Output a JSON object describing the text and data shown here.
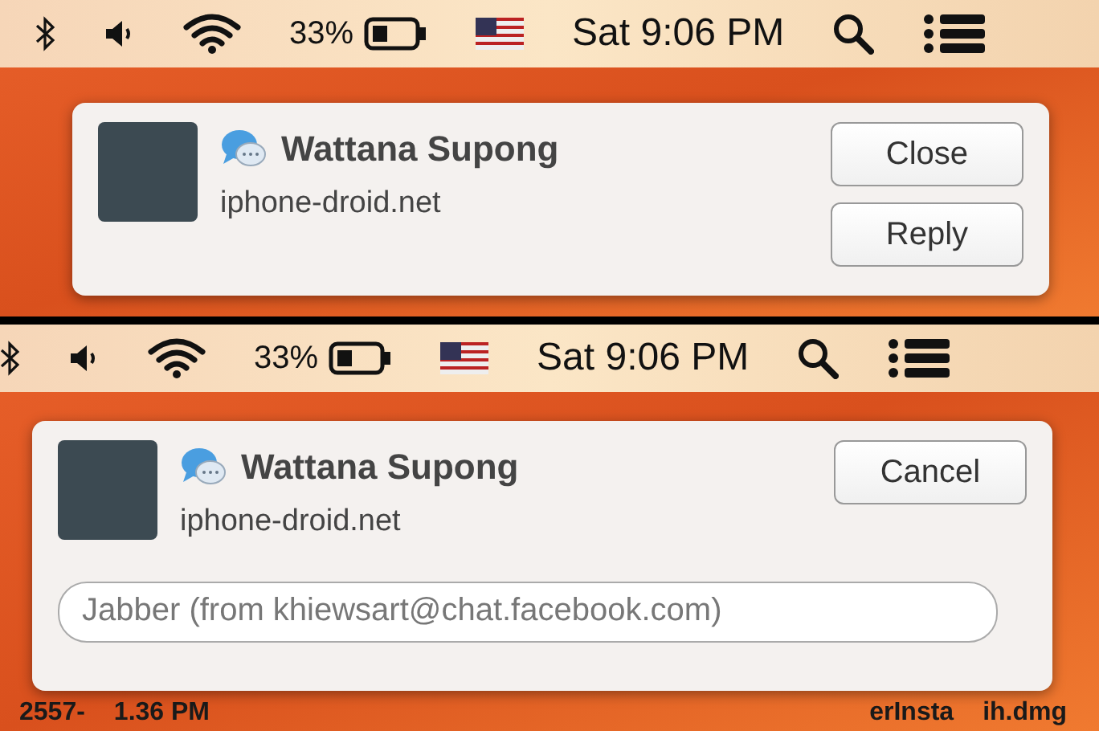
{
  "panels": [
    {
      "menu_bar": {
        "battery_percent": "33%",
        "clock": "Sat 9:06 PM"
      },
      "notification": {
        "sender": "Wattana Supong",
        "subtitle": "iphone-droid.net",
        "buttons": [
          "Close",
          "Reply"
        ]
      }
    },
    {
      "menu_bar": {
        "battery_percent": "33%",
        "clock": "Sat 9:06 PM"
      },
      "notification": {
        "sender": "Wattana Supong",
        "subtitle": "iphone-droid.net",
        "buttons": [
          "Cancel"
        ],
        "reply_field": {
          "placeholder": "Jabber (from khiewsart@chat.facebook.com)"
        }
      },
      "desktop_labels": [
        "2557-",
        "1.36 PM",
        "erInsta",
        "ih.dmg"
      ]
    }
  ]
}
